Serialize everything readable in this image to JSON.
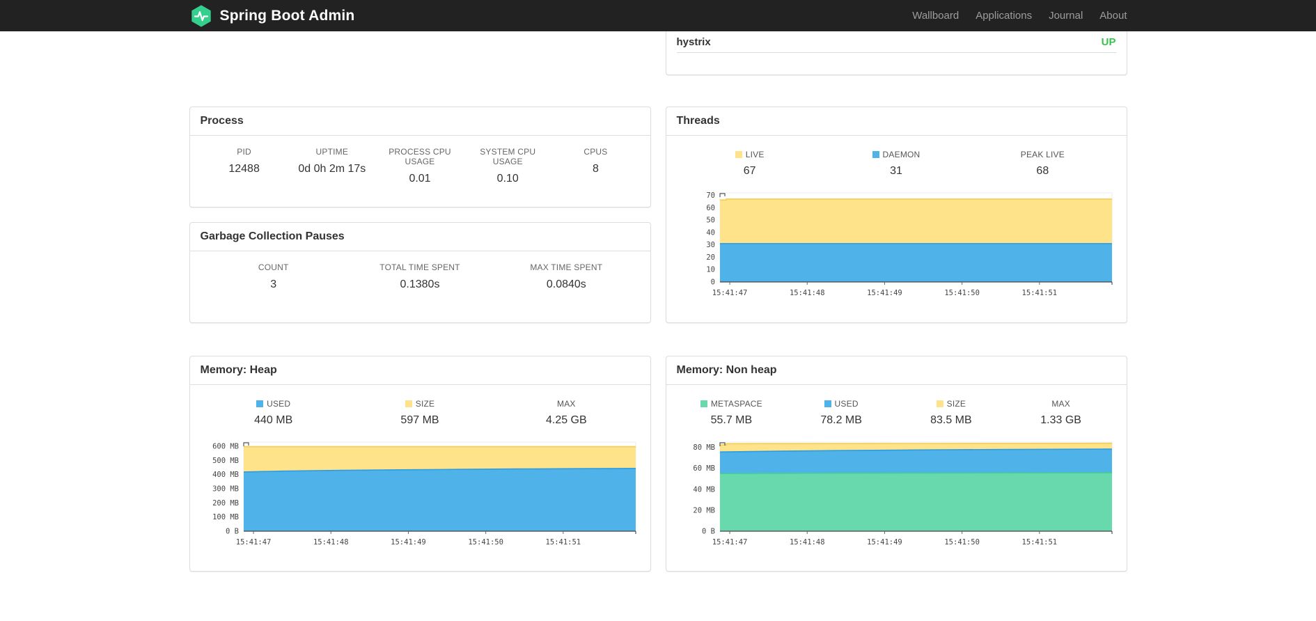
{
  "navbar": {
    "brand": "Spring Boot Admin",
    "items": [
      {
        "label": "Wallboard"
      },
      {
        "label": "Applications"
      },
      {
        "label": "Journal"
      },
      {
        "label": "About"
      }
    ]
  },
  "application_status": {
    "name": "hystrix",
    "status": "UP",
    "status_color": "#3ac14d"
  },
  "colors": {
    "brand_green": "#34ce8d",
    "series_yellow": "#ffe38a",
    "series_blue": "#4fb2e9",
    "series_green": "#68d9ad",
    "navbar_bg": "#222222",
    "panel_border": "#dddddd"
  },
  "panels": {
    "process": {
      "title": "Process",
      "metrics": [
        {
          "label": "PID",
          "value": "12488"
        },
        {
          "label": "UPTIME",
          "value": "0d 0h 2m 17s"
        },
        {
          "label": "PROCESS CPU USAGE",
          "value": "0.01"
        },
        {
          "label": "SYSTEM CPU USAGE",
          "value": "0.10"
        },
        {
          "label": "CPUS",
          "value": "8"
        }
      ]
    },
    "gc": {
      "title": "Garbage Collection Pauses",
      "metrics": [
        {
          "label": "COUNT",
          "value": "3"
        },
        {
          "label": "TOTAL TIME SPENT",
          "value": "0.1380s"
        },
        {
          "label": "MAX TIME SPENT",
          "value": "0.0840s"
        }
      ]
    },
    "threads": {
      "title": "Threads"
    },
    "memory_heap": {
      "title": "Memory: Heap"
    },
    "memory_non_heap": {
      "title": "Memory: Non heap"
    }
  },
  "chart_data": [
    {
      "id": "threads",
      "type": "area",
      "title": "Threads",
      "legend_position": "top",
      "grid": false,
      "legend": [
        {
          "label": "LIVE",
          "value": "67",
          "color": "#ffe38a"
        },
        {
          "label": "DAEMON",
          "value": "31",
          "color": "#4fb2e9"
        },
        {
          "label": "PEAK LIVE",
          "value": "68",
          "color": null
        }
      ],
      "x_ticks": [
        "15:41:47",
        "15:41:48",
        "15:41:49",
        "15:41:50",
        "15:41:51"
      ],
      "y_ticks": [
        {
          "v": 0,
          "label": "0"
        },
        {
          "v": 10,
          "label": "10"
        },
        {
          "v": 20,
          "label": "20"
        },
        {
          "v": 30,
          "label": "30"
        },
        {
          "v": 40,
          "label": "40"
        },
        {
          "v": 50,
          "label": "50"
        },
        {
          "v": 60,
          "label": "60"
        },
        {
          "v": 70,
          "label": "70"
        }
      ],
      "ylim": [
        0,
        72
      ],
      "series": [
        {
          "name": "live",
          "fill": "#ffe38a",
          "stroke": "#f3cd52",
          "values": [
            [
              0,
              66.2
            ],
            [
              0.016,
              66.2
            ],
            [
              0.016,
              67
            ],
            [
              1,
              67
            ]
          ]
        },
        {
          "name": "daemon",
          "fill": "#4fb2e9",
          "stroke": "#2d9ce2",
          "values": [
            [
              0,
              31
            ],
            [
              1,
              31
            ]
          ]
        }
      ]
    },
    {
      "id": "memory-heap",
      "type": "area",
      "title": "Memory: Heap",
      "legend_position": "top",
      "grid": false,
      "legend": [
        {
          "label": "USED",
          "value": "440 MB",
          "color": "#4fb2e9"
        },
        {
          "label": "SIZE",
          "value": "597 MB",
          "color": "#ffe38a"
        },
        {
          "label": "MAX",
          "value": "4.25 GB",
          "color": null
        }
      ],
      "x_ticks": [
        "15:41:47",
        "15:41:48",
        "15:41:49",
        "15:41:50",
        "15:41:51"
      ],
      "y_ticks": [
        {
          "v": 0,
          "label": "0 B"
        },
        {
          "v": 100,
          "label": "100 MB"
        },
        {
          "v": 200,
          "label": "200 MB"
        },
        {
          "v": 300,
          "label": "300 MB"
        },
        {
          "v": 400,
          "label": "400 MB"
        },
        {
          "v": 500,
          "label": "500 MB"
        },
        {
          "v": 600,
          "label": "600 MB"
        }
      ],
      "ylim": [
        0,
        630
      ],
      "series": [
        {
          "name": "size",
          "fill": "#ffe38a",
          "stroke": "#f3cd52",
          "values": [
            [
              0,
              597.5
            ],
            [
              1,
              597.5
            ]
          ]
        },
        {
          "name": "used",
          "fill": "#4fb2e9",
          "stroke": "#2d9ce2",
          "values": [
            [
              0,
              419
            ],
            [
              0.1,
              425
            ],
            [
              0.25,
              430
            ],
            [
              0.4,
              434
            ],
            [
              0.55,
              437
            ],
            [
              0.7,
              440
            ],
            [
              0.85,
              442
            ],
            [
              1,
              444
            ]
          ]
        }
      ]
    },
    {
      "id": "memory-non-heap",
      "type": "area",
      "title": "Memory: Non heap",
      "legend_position": "top",
      "grid": false,
      "legend": [
        {
          "label": "METASPACE",
          "value": "55.7 MB",
          "color": "#68d9ad"
        },
        {
          "label": "USED",
          "value": "78.2 MB",
          "color": "#4fb2e9"
        },
        {
          "label": "SIZE",
          "value": "83.5 MB",
          "color": "#ffe38a"
        },
        {
          "label": "MAX",
          "value": "1.33 GB",
          "color": null
        }
      ],
      "x_ticks": [
        "15:41:47",
        "15:41:48",
        "15:41:49",
        "15:41:50",
        "15:41:51"
      ],
      "y_ticks": [
        {
          "v": 0,
          "label": "0 B"
        },
        {
          "v": 20,
          "label": "20 MB"
        },
        {
          "v": 40,
          "label": "40 MB"
        },
        {
          "v": 60,
          "label": "60 MB"
        },
        {
          "v": 80,
          "label": "80 MB"
        }
      ],
      "ylim": [
        0,
        85
      ],
      "series": [
        {
          "name": "size",
          "fill": "#ffe38a",
          "stroke": "#f3cd52",
          "values": [
            [
              0,
              82.3
            ],
            [
              0.016,
              82.3
            ],
            [
              0.016,
              83.5
            ],
            [
              0.5,
              83.7
            ],
            [
              1,
              83.9
            ]
          ]
        },
        {
          "name": "used",
          "fill": "#4fb2e9",
          "stroke": "#2d9ce2",
          "values": [
            [
              0,
              75.6
            ],
            [
              0.15,
              76.3
            ],
            [
              0.3,
              76.9
            ],
            [
              0.5,
              77.5
            ],
            [
              0.7,
              77.9
            ],
            [
              1,
              78.3
            ]
          ]
        },
        {
          "name": "metaspace",
          "fill": "#68d9ad",
          "stroke": "#43cf96",
          "values": [
            [
              0,
              55.0
            ],
            [
              0.3,
              55.3
            ],
            [
              0.6,
              55.5
            ],
            [
              1,
              55.7
            ]
          ]
        }
      ]
    }
  ]
}
